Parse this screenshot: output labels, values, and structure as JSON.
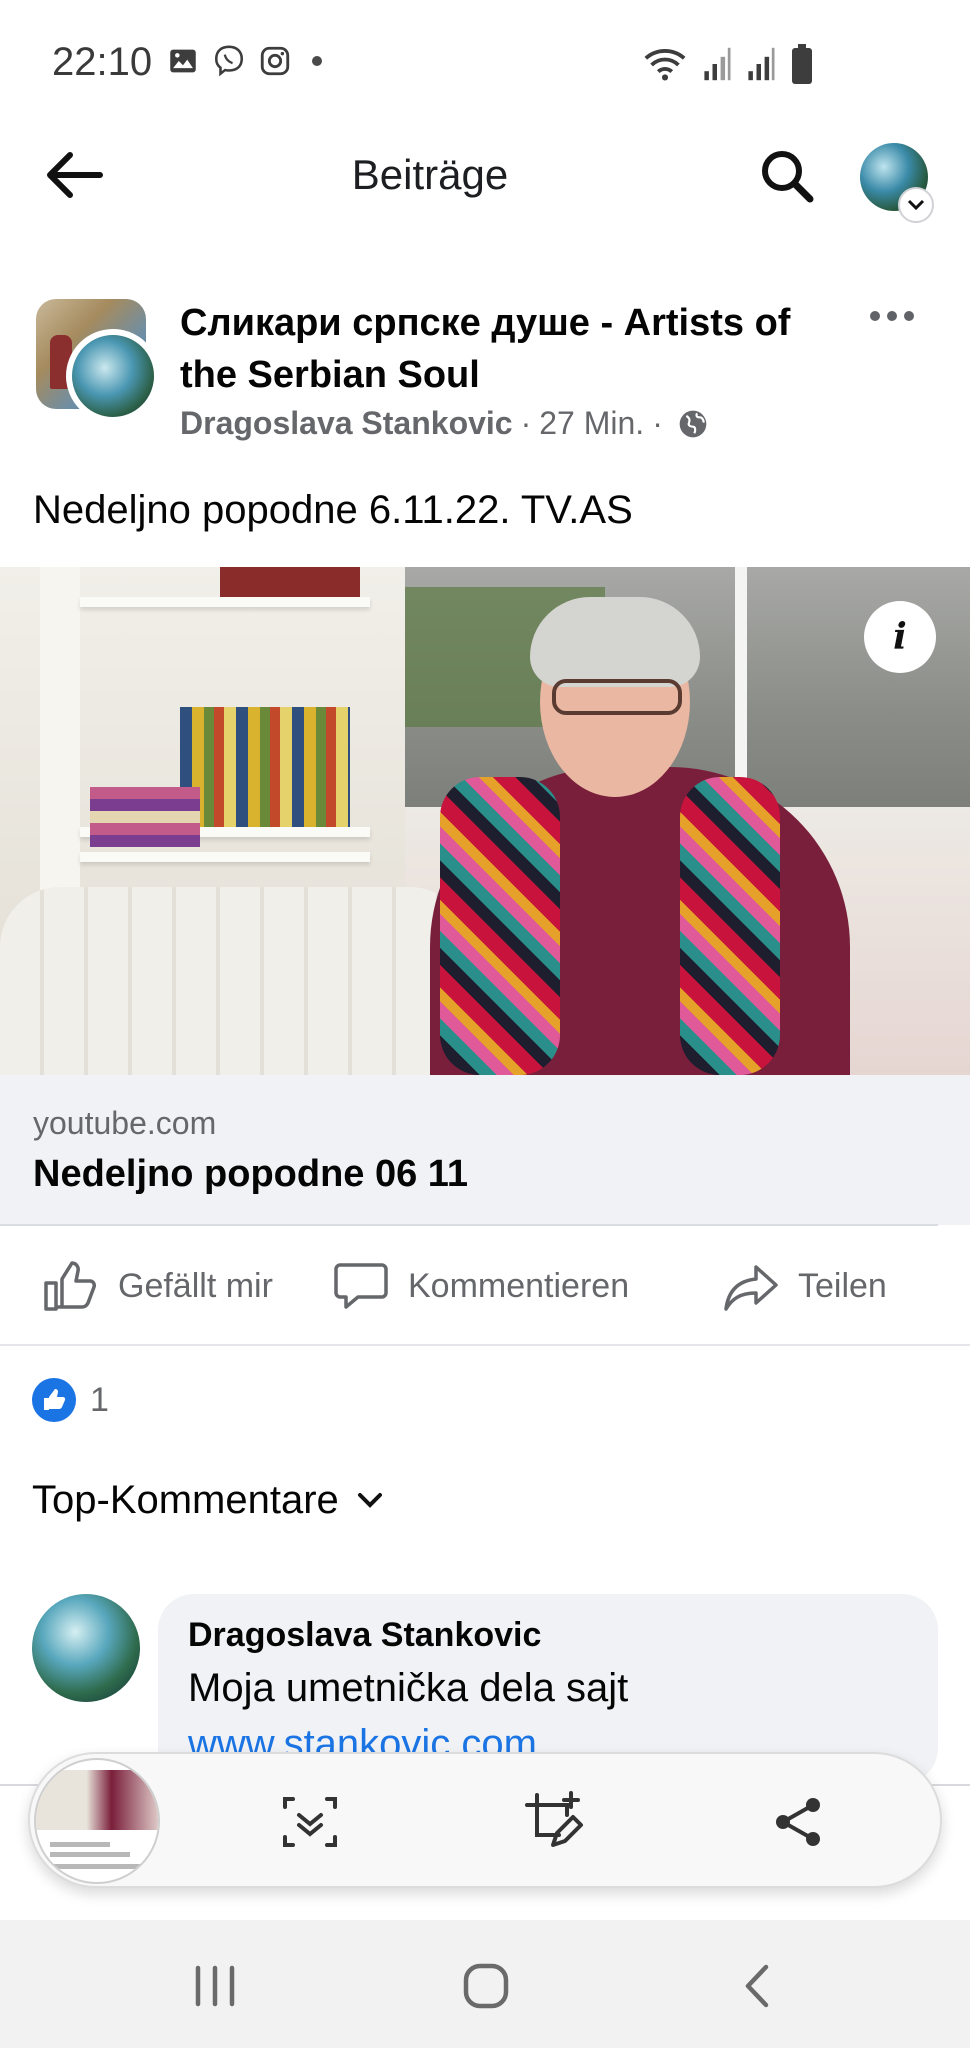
{
  "status_bar": {
    "time": "22:10",
    "icons_left": [
      "gallery-icon",
      "viber-icon",
      "instagram-icon",
      "notification-dot"
    ],
    "icons_right": [
      "wifi-icon",
      "signal-icon",
      "signal-icon",
      "battery-icon"
    ]
  },
  "app_bar": {
    "title": "Beiträge",
    "icons": [
      "back-arrow-icon",
      "search-icon",
      "profile-avatar"
    ]
  },
  "post": {
    "group_name": "Сликари српске душе - Artists of the Serbian Soul",
    "author": "Dragoslava Stankovic",
    "separator": "·",
    "time": "27 Min.",
    "privacy_icon": "globe-icon",
    "text": "Nedeljno popodne 6.11.22. TV.AS",
    "link": {
      "domain": "youtube.com",
      "title": "Nedeljno popodne 06 11",
      "info_label": "i"
    }
  },
  "actions": {
    "like": "Gefällt mir",
    "comment": "Kommentieren",
    "share": "Teilen"
  },
  "reactions": {
    "count": "1",
    "type": "like"
  },
  "comments": {
    "filter_label": "Top-Kommentare",
    "items": [
      {
        "author": "Dragoslava Stankovic",
        "text": "Moja umetnička dela sajt",
        "link": "www.stankovic.com"
      }
    ]
  },
  "screenshot_toolbar": {
    "buttons": [
      "scroll-capture-icon",
      "edit-crop-icon",
      "share-icon"
    ]
  },
  "nav_bar": {
    "buttons": [
      "recents-icon",
      "home-icon",
      "back-icon"
    ]
  },
  "colors": {
    "accent_blue": "#1b74e4",
    "text_primary": "#050505",
    "text_secondary": "#65676b",
    "bubble_bg": "#f0f2f5"
  }
}
